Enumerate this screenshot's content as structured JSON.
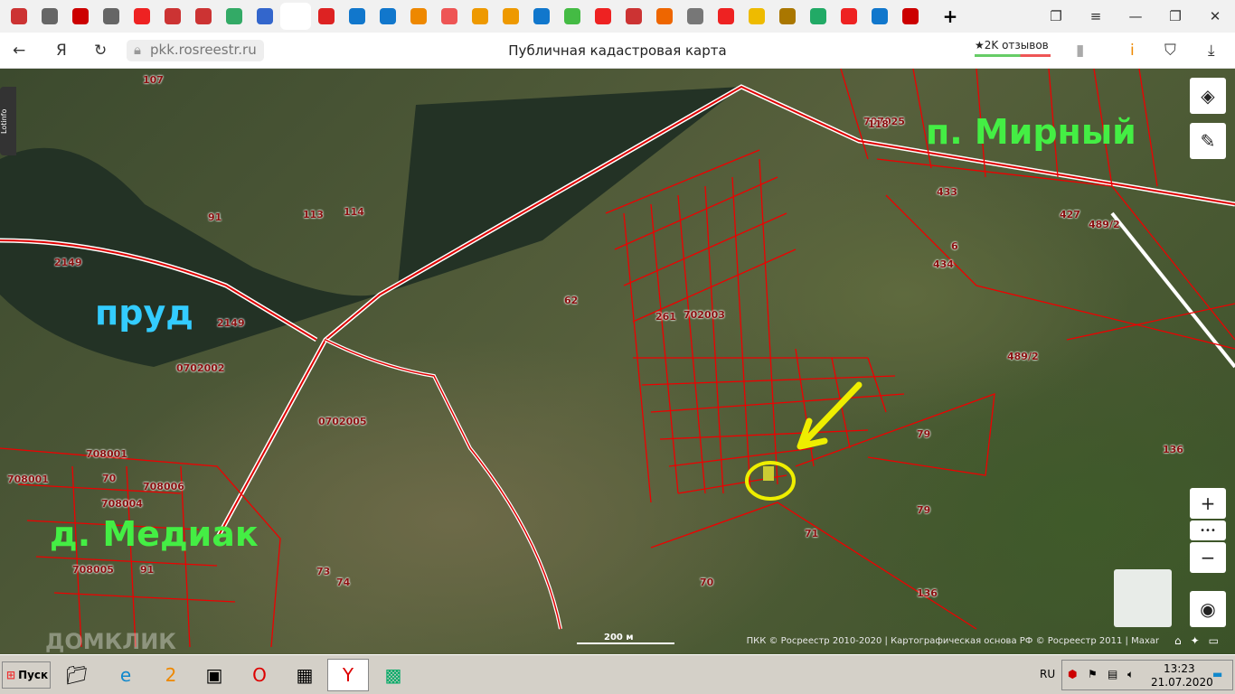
{
  "browser": {
    "tabs": [
      "ya",
      "doc",
      "vk",
      "doc",
      "Я",
      "RN",
      "RN",
      "g",
      "ru",
      "pkk",
      "star",
      "@",
      "mail",
      "ok",
      "dots",
      "Li",
      "Li",
      "up",
      "g2",
      "Я",
      "ru2",
      "shield",
      "cat",
      "Я",
      "home",
      "cup",
      "map",
      "Я",
      "edge",
      "abp"
    ],
    "new_tab": "+",
    "url": "pkk.rosreestr.ru",
    "page_title": "Публичная кадастровая карта",
    "reviews": "★2K отзывов",
    "nav": {
      "back": "←",
      "home": "Я",
      "reload": "↻"
    }
  },
  "map": {
    "big_labels": {
      "pond": "пруд",
      "mirny": "п. Мирный",
      "mediak": "д. Медиак"
    },
    "parcels": [
      "107",
      "91",
      "113",
      "114",
      "2149",
      "2149",
      "0702002",
      "0702005",
      "62",
      "261",
      "702003",
      "708001",
      "708001",
      "70",
      "708006",
      "708004",
      "708005",
      "91",
      "73",
      "74",
      "707025",
      "118",
      "433",
      "6",
      "434",
      "427",
      "489/2",
      "489/2",
      "79",
      "79",
      "136",
      "136",
      "71",
      "70"
    ],
    "scale": "200 м",
    "attribution": "ПКК © Росреестр 2010-2020 | Картографическая основа РФ © Росреестр 2011 | Maxar",
    "watermark": "ДОМКЛИК",
    "lotinfo": "Lotinfo",
    "zoom_in": "+",
    "more": "•••",
    "zoom_out": "−"
  },
  "taskbar": {
    "start": "Пуск",
    "lang": "RU",
    "time": "13:23",
    "date": "21.07.2020"
  }
}
